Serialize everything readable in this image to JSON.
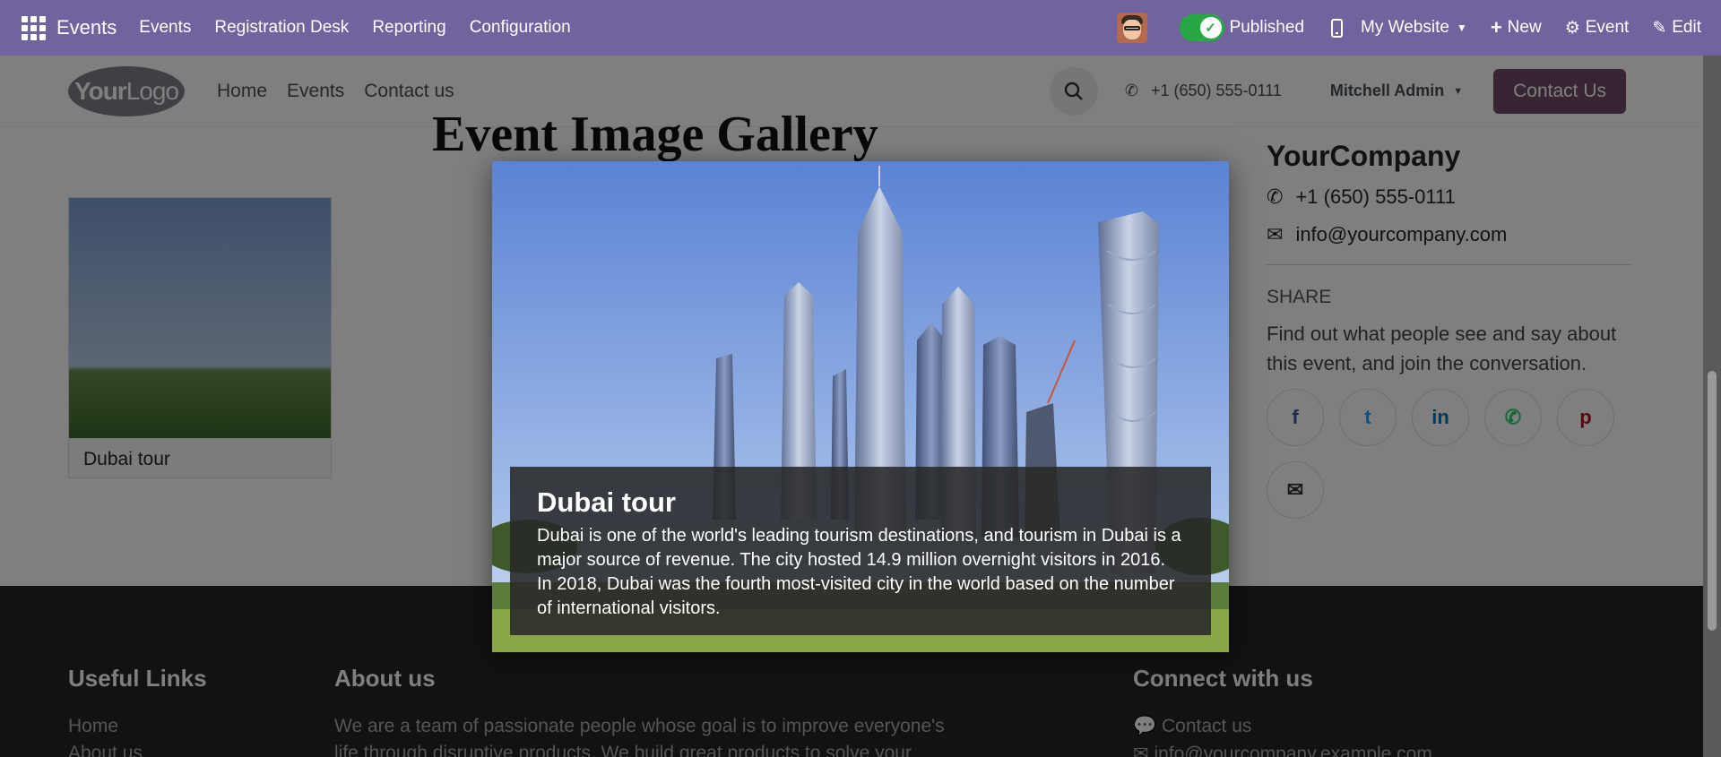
{
  "topbar": {
    "app_name": "Events",
    "menu": [
      "Events",
      "Registration Desk",
      "Reporting",
      "Configuration"
    ],
    "published_label": "Published",
    "website_label": "My Website",
    "new_label": "New",
    "event_label": "Event",
    "edit_label": "Edit"
  },
  "site_header": {
    "logo_text_bold": "Your",
    "logo_text": "Logo",
    "nav": [
      "Home",
      "Events",
      "Contact us"
    ],
    "phone": "+1 (650) 555-0111",
    "user": "Mitchell Admin",
    "cta": "Contact Us"
  },
  "page": {
    "gallery_title": "Event Image Gallery",
    "card_caption": "Dubai tour"
  },
  "sidebar": {
    "company": "YourCompany",
    "phone": "+1 (650) 555-0111",
    "email": "info@yourcompany.com",
    "share_heading": "SHARE",
    "share_text": "Find out what people see and say about this event, and join the conversation.",
    "socials": [
      "facebook-icon",
      "twitter-icon",
      "linkedin-icon",
      "whatsapp-icon",
      "pinterest-icon",
      "envelope-icon"
    ]
  },
  "footer": {
    "useful_links_title": "Useful Links",
    "useful_links": [
      "Home",
      "About us"
    ],
    "about_title": "About us",
    "about_text_1": "We are a team of passionate people whose goal is to improve everyone's",
    "about_text_2": "life through disruptive products. We build great products to solve your",
    "connect_title": "Connect with us",
    "connect_contact": "Contact us",
    "connect_email": "info@yourcompany.example.com"
  },
  "lightbox": {
    "title": "Dubai tour",
    "description": "Dubai is one of the world's leading tourism destinations, and tourism in Dubai is a major source of revenue. The city hosted 14.9 million overnight visitors in 2016. In 2018, Dubai was the fourth most-visited city in the world based on the number of international visitors."
  },
  "colors": {
    "odoo_bar": "#71639e",
    "published_toggle": "#28a745",
    "cta": "#714b67",
    "footer": "#212529"
  }
}
